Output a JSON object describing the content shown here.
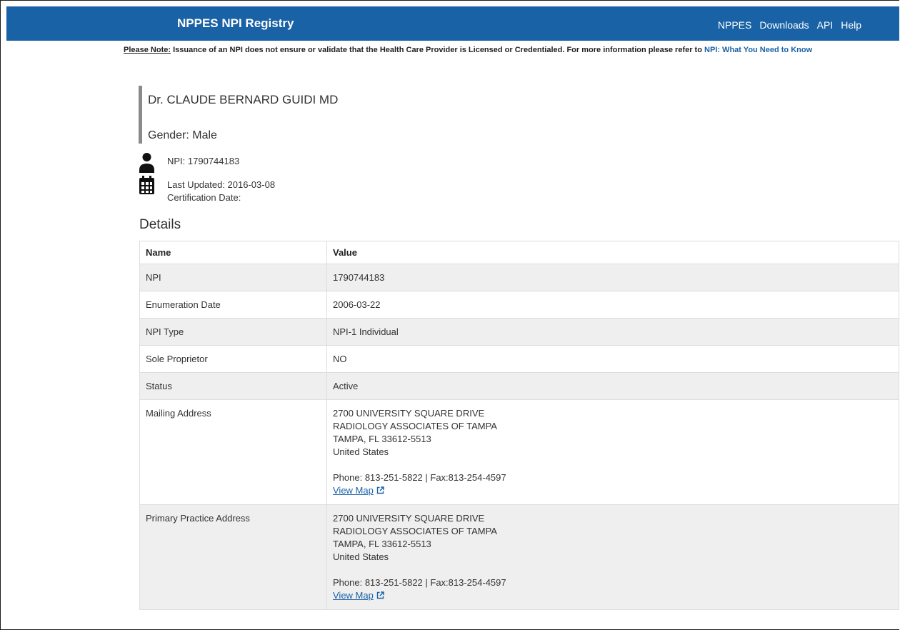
{
  "header": {
    "brand": "NPPES NPI Registry",
    "nav": [
      "NPPES",
      "Downloads",
      "API",
      "Help"
    ],
    "bg_color": "#1a62a6"
  },
  "notice": {
    "label": "Please Note:",
    "text": " Issuance of an NPI does not ensure or validate that the Health Care Provider is Licensed or Credentialed. For more information please refer to ",
    "link": "NPI: What You Need to Know"
  },
  "provider": {
    "name": "Dr. CLAUDE BERNARD GUIDI MD",
    "gender": "Gender: Male",
    "npi": "NPI: 1790744183",
    "last_updated": "Last Updated: 2016-03-08",
    "certification": "Certification Date:"
  },
  "details": {
    "heading": "Details",
    "columns": [
      "Name",
      "Value"
    ],
    "rows": [
      {
        "name": "NPI",
        "value": "1790744183"
      },
      {
        "name": "Enumeration Date",
        "value": "2006-03-22"
      },
      {
        "name": "NPI Type",
        "value": "NPI-1 Individual"
      },
      {
        "name": "Sole Proprietor",
        "value": "NO"
      },
      {
        "name": "Status",
        "value": "Active"
      }
    ],
    "mailing": {
      "name": "Mailing Address",
      "lines": [
        "2700 UNIVERSITY SQUARE DRIVE",
        "RADIOLOGY ASSOCIATES OF TAMPA",
        "TAMPA, FL 33612-5513",
        "United States"
      ],
      "phone": "Phone: 813-251-5822 | Fax:813-254-4597",
      "map": "View Map"
    },
    "practice": {
      "name": "Primary Practice Address",
      "lines": [
        "2700 UNIVERSITY SQUARE DRIVE",
        "RADIOLOGY ASSOCIATES OF TAMPA",
        "TAMPA, FL 33612-5513",
        "United States"
      ],
      "phone": "Phone: 813-251-5822 | Fax:813-254-4597",
      "map": "View Map"
    }
  },
  "icons": {
    "person": "user-icon",
    "calendar": "calendar-icon",
    "external": "external-link-icon"
  }
}
